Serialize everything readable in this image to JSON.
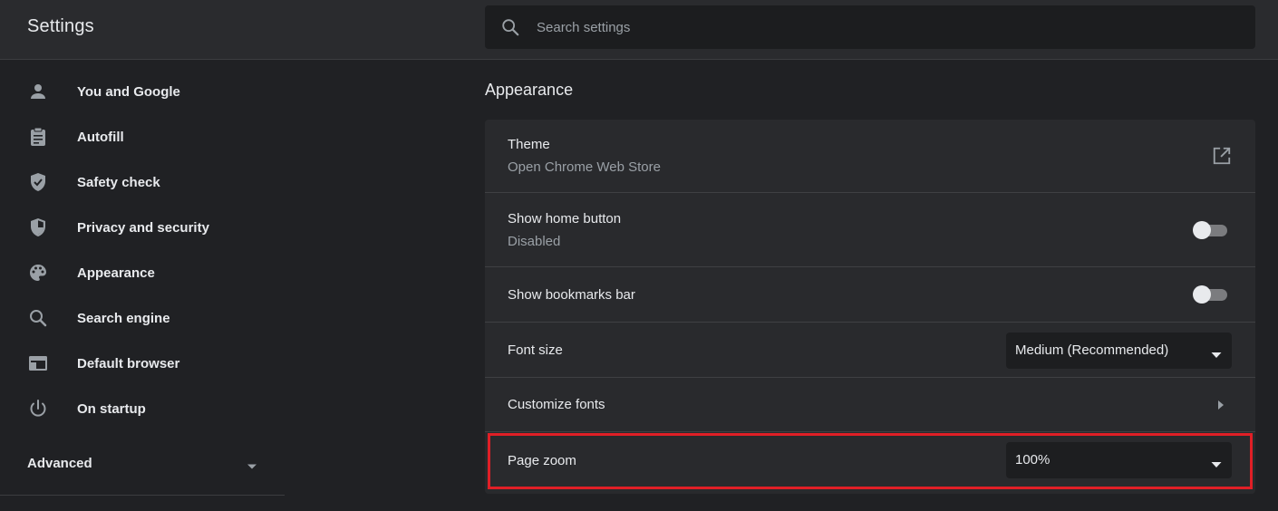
{
  "app": {
    "title": "Settings"
  },
  "search": {
    "placeholder": "Search settings",
    "icon": "search-icon"
  },
  "sidebar": {
    "items": [
      {
        "label": "You and Google",
        "icon": "person-icon"
      },
      {
        "label": "Autofill",
        "icon": "clipboard-icon"
      },
      {
        "label": "Safety check",
        "icon": "shield-check-icon"
      },
      {
        "label": "Privacy and security",
        "icon": "shield-half-icon"
      },
      {
        "label": "Appearance",
        "icon": "palette-icon"
      },
      {
        "label": "Search engine",
        "icon": "search-icon"
      },
      {
        "label": "Default browser",
        "icon": "browser-window-icon"
      },
      {
        "label": "On startup",
        "icon": "power-icon"
      }
    ],
    "advanced": {
      "label": "Advanced",
      "icon": "caret-down-icon"
    }
  },
  "appearance": {
    "title": "Appearance",
    "theme": {
      "label": "Theme",
      "sublabel": "Open Chrome Web Store",
      "icon": "external-link-icon"
    },
    "home_button": {
      "label": "Show home button",
      "sublabel": "Disabled",
      "enabled": false
    },
    "bookmarks_bar": {
      "label": "Show bookmarks bar",
      "enabled": false
    },
    "font_size": {
      "label": "Font size",
      "value": "Medium (Recommended)"
    },
    "customize_fonts": {
      "label": "Customize fonts",
      "icon": "chevron-right-icon"
    },
    "page_zoom": {
      "label": "Page zoom",
      "value": "100%"
    }
  },
  "colors": {
    "background": "#202124",
    "card": "#292a2d",
    "text": "#e8eaed",
    "secondary_text": "#9aa0a6",
    "highlight": "#e01f26"
  }
}
